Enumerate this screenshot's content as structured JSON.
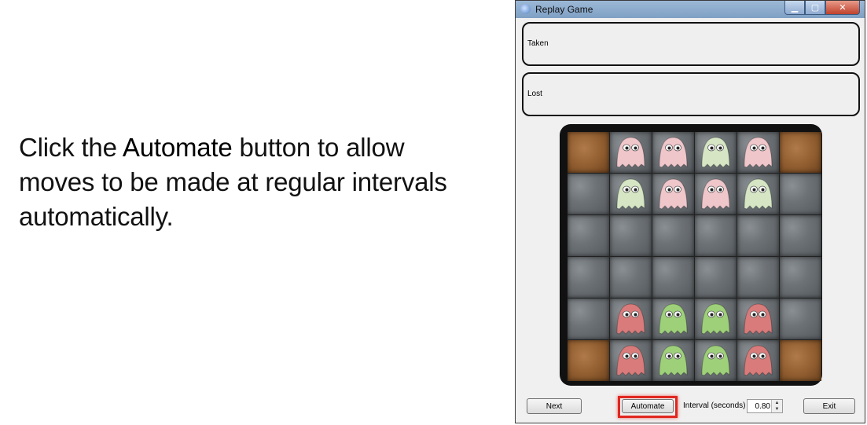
{
  "caption": {
    "part1": "Click the ",
    "bold": "Automate",
    "part2": " button to allow moves to be made at regular intervals automatically."
  },
  "window": {
    "title": "Replay Game",
    "icon": "ghost-app-icon",
    "controls": [
      "minimize-icon",
      "maximize-icon",
      "close-icon"
    ]
  },
  "panels": {
    "taken_label": "Taken",
    "lost_label": "Lost"
  },
  "board": {
    "rows": [
      [
        "dirt",
        "pink",
        "pink",
        "green",
        "pink",
        "dirt"
      ],
      [
        "stone",
        "green",
        "pink",
        "pink",
        "green",
        "stone"
      ],
      [
        "stone",
        "stone",
        "stone",
        "stone",
        "stone",
        "stone"
      ],
      [
        "stone",
        "stone",
        "stone",
        "stone",
        "stone",
        "stone"
      ],
      [
        "stone",
        "red",
        "green",
        "green",
        "red",
        "stone"
      ],
      [
        "dirt",
        "red",
        "green",
        "green",
        "red",
        "dirt"
      ]
    ],
    "colors": {
      "pink": "#efc6ca",
      "green": "#d6e6c4",
      "red": "#d97b7b",
      "green_dark": "#9ed07a"
    }
  },
  "controls": {
    "next_label": "Next",
    "automate_label": "Automate",
    "interval_label": "Interval (seconds)",
    "interval_value": "0.80",
    "exit_label": "Exit"
  },
  "highlight_color": "#e0261f"
}
